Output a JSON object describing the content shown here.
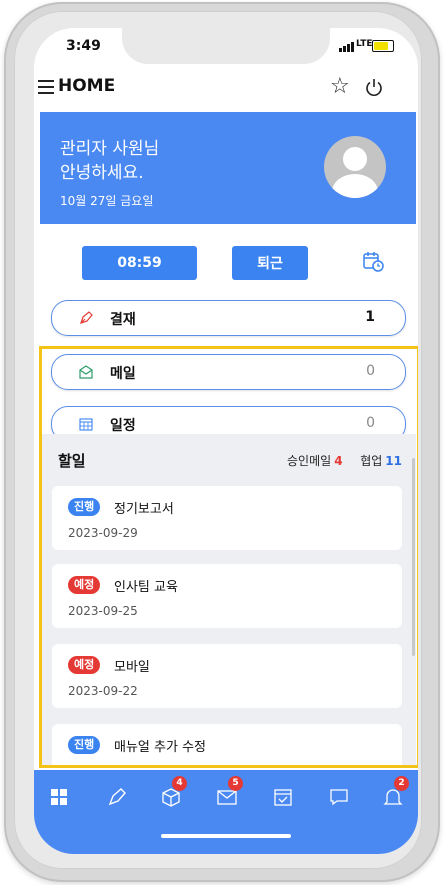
{
  "status_bar": {
    "time": "3:49",
    "network": "LTE",
    "battery_level": 0.7
  },
  "header": {
    "title": "HOME",
    "menu_icon": "hamburger-icon",
    "favorite_icon": "star-icon",
    "power_icon": "power-icon"
  },
  "welcome": {
    "line1": "관리자 사원님",
    "line2": "안녕하세요.",
    "date": "10월 27일 금요일",
    "background": "#4a88f2"
  },
  "attendance": {
    "clock_in_time": "08:59",
    "leave_label": "퇴근",
    "history_icon": "calendar-clock-icon"
  },
  "rows": [
    {
      "label": "결재",
      "count": "1",
      "icon": "pen-icon"
    },
    {
      "label": "메일",
      "count": "0",
      "icon": "mail-open-icon"
    },
    {
      "label": "일정",
      "count": "0",
      "icon": "calendar-icon"
    }
  ],
  "todo": {
    "title": "할일",
    "approval_mail_label": "승인메일",
    "approval_mail_count": "4",
    "collab_label": "협업",
    "collab_count": "11",
    "items": [
      {
        "badge": "진행",
        "status": "progress",
        "name": "정기보고서",
        "date": "2023-09-29"
      },
      {
        "badge": "예정",
        "status": "planned",
        "name": "인사팀 교육",
        "date": "2023-09-25"
      },
      {
        "badge": "예정",
        "status": "planned",
        "name": "모바일",
        "date": "2023-09-22"
      },
      {
        "badge": "진행",
        "status": "progress",
        "name": "매뉴얼 추가 수정",
        "date": ""
      }
    ]
  },
  "bottom_nav": {
    "items": [
      {
        "icon": "grid-icon",
        "badge": ""
      },
      {
        "icon": "pen-icon",
        "badge": ""
      },
      {
        "icon": "box-icon",
        "badge": "4"
      },
      {
        "icon": "mail-icon",
        "badge": "5"
      },
      {
        "icon": "calendar-check-icon",
        "badge": ""
      },
      {
        "icon": "chat-icon",
        "badge": ""
      },
      {
        "icon": "bell-icon",
        "badge": "2"
      }
    ]
  },
  "colors": {
    "primary": "#3a83f0",
    "highlight": "#f4c318",
    "badge_red": "#e53935"
  }
}
